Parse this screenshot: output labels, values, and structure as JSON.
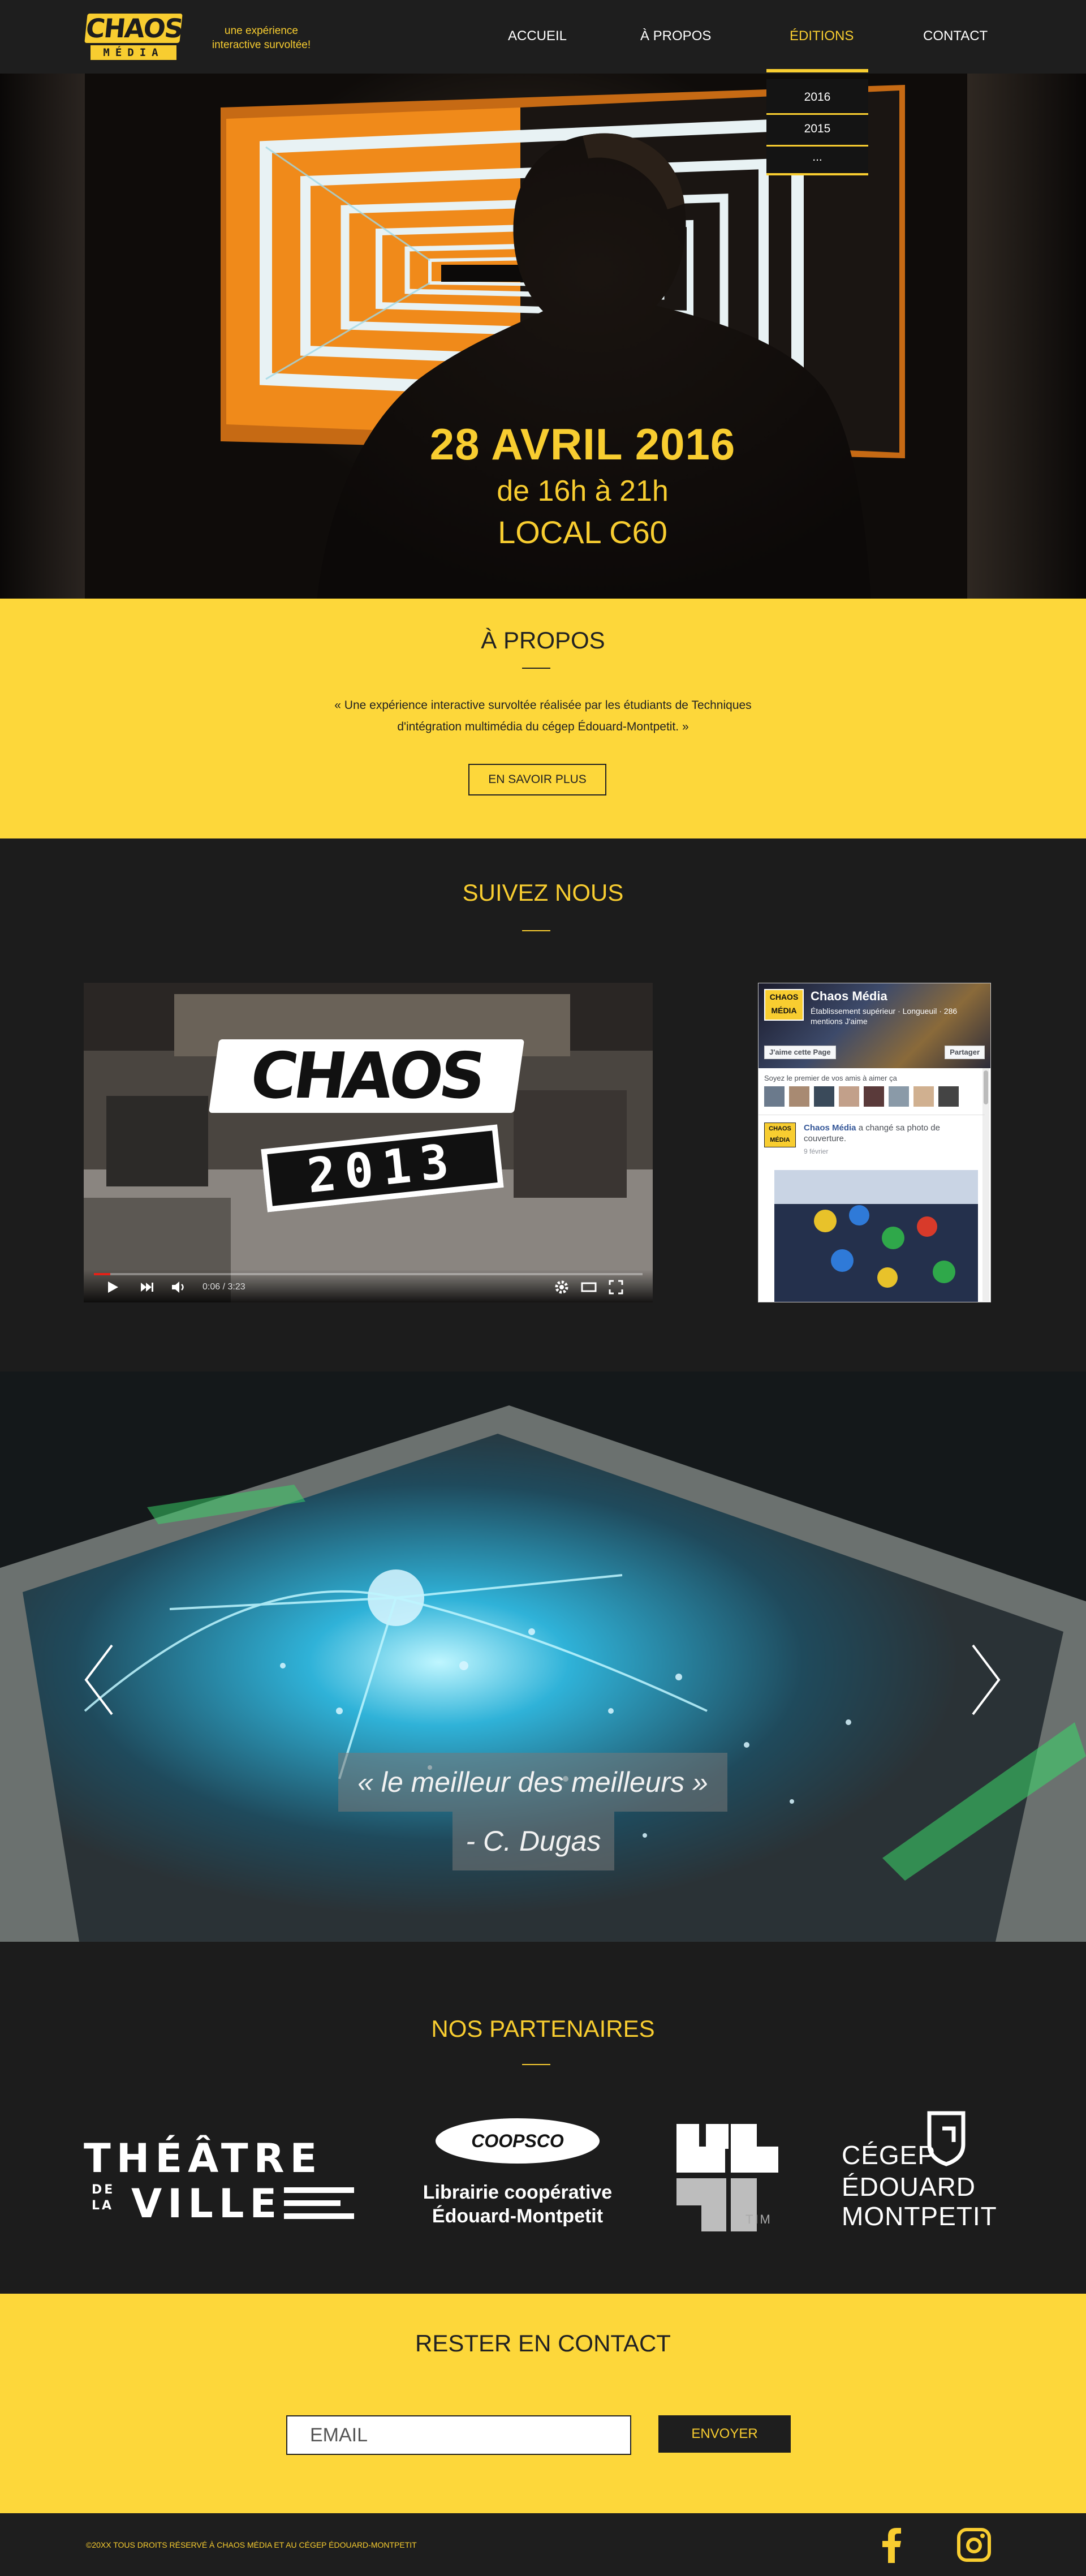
{
  "colors": {
    "accent": "#f8cd30",
    "dark": "#1c1c1c",
    "yellow_bg": "#fdd73a"
  },
  "header": {
    "logo_top": "CHAOS",
    "logo_bottom": "MÉDIA",
    "tagline": "une expérience interactive survoltée!",
    "nav": [
      {
        "label": "ACCUEIL",
        "active": false
      },
      {
        "label": "À PROPOS",
        "active": false
      },
      {
        "label": "ÉDITIONS",
        "active": true
      },
      {
        "label": "CONTACT",
        "active": false
      }
    ],
    "editions_dropdown": [
      "2016",
      "2015",
      "..."
    ]
  },
  "hero": {
    "date": "28 AVRIL 2016",
    "time": "de 16h à 21h",
    "place": "LOCAL C60"
  },
  "about": {
    "title": "À PROPOS",
    "text": "« Une expérience interactive survoltée réalisée par les étudiants de Techniques d'intégration multimédia du cégep Édouard-Montpetit. »",
    "button": "EN SAVOIR PLUS"
  },
  "social": {
    "title": "SUIVEZ NOUS",
    "video": {
      "overlay_top": "CHAOS",
      "overlay_year": "2013",
      "time": "0:06 / 3:23",
      "progress": 0.03
    },
    "facebook": {
      "cover_logo": "CHAOS MÉDIA",
      "page_name": "Chaos Média",
      "page_sub": "Établissement supérieur · Longueuil · 286 mentions J'aime",
      "like_button": "J'aime cette Page",
      "share_button": "Partager",
      "friends_text": "Soyez le premier de vos amis à aimer ça",
      "post_author": "Chaos Média",
      "post_text": " a changé sa photo de couverture.",
      "post_date": "9 février"
    }
  },
  "carousel": {
    "quote": "« le meilleur des meilleurs »",
    "author": "- C. Dugas",
    "prev_icon": "chevron-left-icon",
    "next_icon": "chevron-right-icon"
  },
  "partners": {
    "title": "NOS PARTENAIRES",
    "theatre": {
      "line1": "THÉÂTRE",
      "de": "DE",
      "la": "LA",
      "line2": "VILLE"
    },
    "coopsco": {
      "oval": "COOPSCO",
      "line1": "Librairie coopérative",
      "line2": "Édouard-Montpetit"
    },
    "tim": {
      "label": "TIM"
    },
    "cegep": {
      "line1": "CÉGEP",
      "line2": "ÉDOUARD",
      "line3": "MONTPETIT"
    }
  },
  "contact": {
    "title": "RESTER EN CONTACT",
    "email_placeholder": "EMAIL",
    "send_button": "ENVOYER"
  },
  "footer": {
    "copyright": "©20XX TOUS DROITS RÉSERVÉ À CHAOS MÉDIA ET AU CÉGEP ÉDOUARD-MONTPETIT",
    "icons": [
      "facebook-icon",
      "instagram-icon"
    ]
  }
}
